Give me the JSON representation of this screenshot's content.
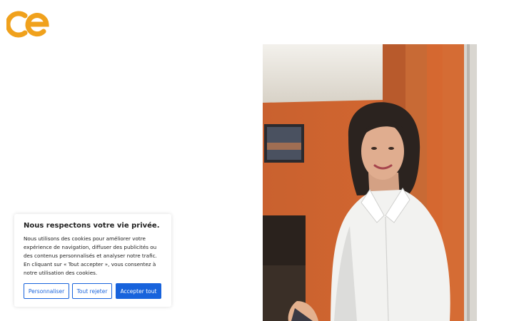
{
  "brand": {
    "logo_color": "#f0a11c"
  },
  "cookie_banner": {
    "title": "Nous respectons votre vie privée.",
    "body": "Nous utilisons des cookies pour améliorer votre expérience de navigation, diffuser des publicités ou des contenus personnalisés et analyser notre trafic. En cliquant sur « Tout accepter », vous consentez à notre utilisation des cookies.",
    "buttons": {
      "customize": "Personnaliser",
      "reject_all": "Tout rejeter",
      "accept_all": "Accepter tout"
    },
    "accent_color": "#1863dc"
  },
  "photo": {
    "subject": "smiling woman in white shirt against orange wall"
  }
}
